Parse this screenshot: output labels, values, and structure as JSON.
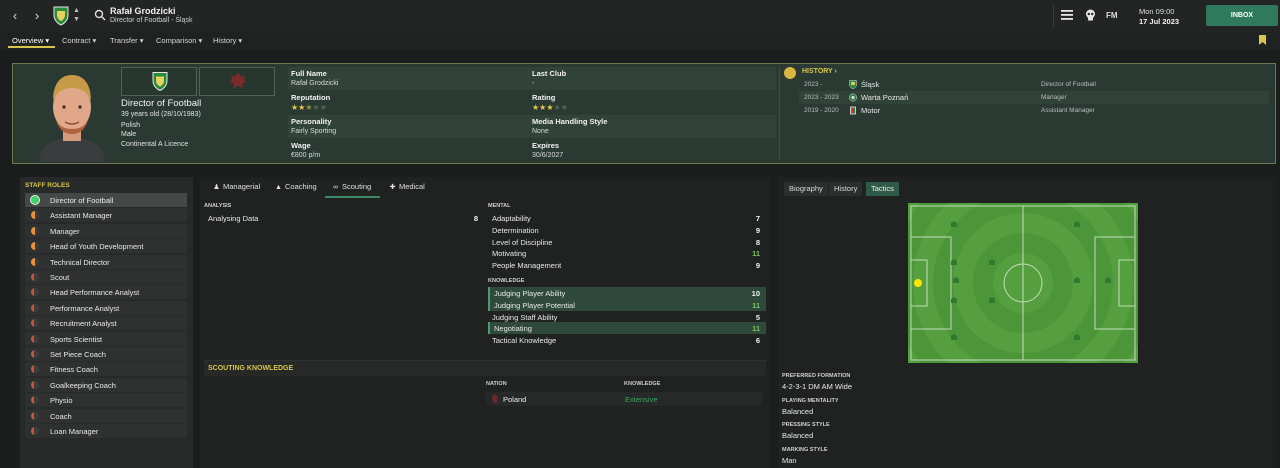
{
  "topbar": {
    "person_name": "Rafał Grodzicki",
    "person_subtitle": "Director of Football - Śląsk",
    "fm_label": "FM",
    "date_day": "Mon 09:00",
    "date_full": "17 Jul 2023",
    "inbox_label": "INBOX"
  },
  "subnav": [
    {
      "label": "Overview"
    },
    {
      "label": "Contract"
    },
    {
      "label": "Transfer"
    },
    {
      "label": "Comparison"
    },
    {
      "label": "History"
    }
  ],
  "profile": {
    "role": "Director of Football",
    "age": "39 years old (28/10/1983)",
    "nationality": "Polish",
    "gender": "Male",
    "licence": "Continental A Licence",
    "full_name_label": "Full Name",
    "full_name": "Rafał Grodzicki",
    "last_club_label": "Last Club",
    "last_club": "-",
    "reputation_label": "Reputation",
    "reputation_stars": 2.5,
    "rating_label": "Rating",
    "rating_stars": 3,
    "personality_label": "Personality",
    "personality": "Fairly Sporting",
    "media_label": "Media Handling Style",
    "media": "None",
    "wage_label": "Wage",
    "wage": "€800 p/m",
    "expires_label": "Expires",
    "expires": "30/6/2027"
  },
  "history": {
    "title": "HISTORY",
    "rows": [
      {
        "years": "2023 -",
        "club": "Śląsk",
        "role": "Director of Football"
      },
      {
        "years": "2023 - 2023",
        "club": "Warta Poznań",
        "role": "Manager"
      },
      {
        "years": "2019 - 2020",
        "club": "Motor",
        "role": "Assistant Manager"
      }
    ]
  },
  "staff_roles": {
    "title": "STAFF ROLES",
    "items": [
      {
        "label": "Director of Football",
        "dot": "full"
      },
      {
        "label": "Assistant Manager",
        "dot": "half"
      },
      {
        "label": "Manager",
        "dot": "half"
      },
      {
        "label": "Head of Youth Development",
        "dot": "half"
      },
      {
        "label": "Technical Director",
        "dot": "half"
      },
      {
        "label": "Scout",
        "dot": "low"
      },
      {
        "label": "Head Performance Analyst",
        "dot": "low"
      },
      {
        "label": "Performance Analyst",
        "dot": "low"
      },
      {
        "label": "Recruitment Analyst",
        "dot": "low"
      },
      {
        "label": "Sports Scientist",
        "dot": "low"
      },
      {
        "label": "Set Piece Coach",
        "dot": "low"
      },
      {
        "label": "Fitness Coach",
        "dot": "low"
      },
      {
        "label": "Goalkeeping Coach",
        "dot": "low"
      },
      {
        "label": "Physio",
        "dot": "low"
      },
      {
        "label": "Coach",
        "dot": "low"
      },
      {
        "label": "Loan Manager",
        "dot": "low"
      }
    ]
  },
  "center_tabs": [
    {
      "label": "Managerial"
    },
    {
      "label": "Coaching"
    },
    {
      "label": "Scouting"
    },
    {
      "label": "Medical"
    }
  ],
  "analysis": {
    "heading": "ANALYSIS",
    "rows": [
      {
        "name": "Analysing Data",
        "value": "8"
      }
    ]
  },
  "mental": {
    "heading": "MENTAL",
    "rows": [
      {
        "name": "Adaptability",
        "value": "7"
      },
      {
        "name": "Determination",
        "value": "9"
      },
      {
        "name": "Level of Discipline",
        "value": "8"
      },
      {
        "name": "Motivating",
        "value": "11"
      },
      {
        "name": "People Management",
        "value": "9"
      }
    ]
  },
  "knowledge": {
    "heading": "KNOWLEDGE",
    "rows": [
      {
        "name": "Judging Player Ability",
        "value": "10"
      },
      {
        "name": "Judging Player Potential",
        "value": "11"
      },
      {
        "name": "Judging Staff Ability",
        "value": "5"
      },
      {
        "name": "Negotiating",
        "value": "11"
      },
      {
        "name": "Tactical Knowledge",
        "value": "6"
      }
    ]
  },
  "scouting_knowledge": {
    "title": "SCOUTING KNOWLEDGE",
    "nation_header": "NATION",
    "knowledge_header": "KNOWLEDGE",
    "nation": "Poland",
    "level": "Extensive"
  },
  "right_tabs": [
    {
      "label": "Biography"
    },
    {
      "label": "History"
    },
    {
      "label": "Tactics"
    }
  ],
  "tactics": {
    "formation_label": "PREFERRED FORMATION",
    "formation": "4-2-3-1 DM AM Wide",
    "mentality_label": "PLAYING MENTALITY",
    "mentality": "Balanced",
    "pressing_label": "PRESSING STYLE",
    "pressing": "Balanced",
    "marking_label": "MARKING STYLE",
    "marking": "Man"
  },
  "colors": {
    "accent_yellow": "#d9c64a",
    "positive_green": "#7cc35b",
    "inbox_green": "#2f7a5c"
  }
}
